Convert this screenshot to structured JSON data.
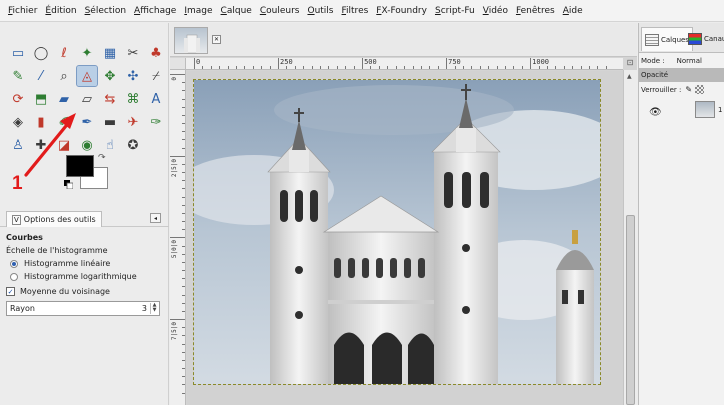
{
  "menubar": {
    "items": [
      "Fichier",
      "Édition",
      "Sélection",
      "Affichage",
      "Image",
      "Calque",
      "Couleurs",
      "Outils",
      "Filtres",
      "FX-Foundry",
      "Script-Fu",
      "Vidéo",
      "Fenêtres",
      "Aide"
    ]
  },
  "toolbox": {
    "annotation_number": "1",
    "tools": [
      {
        "name": "rect-select-tool-icon",
        "glyph": "▭"
      },
      {
        "name": "ellipse-select-tool-icon",
        "glyph": "◯"
      },
      {
        "name": "free-select-tool-icon",
        "glyph": "ℓ"
      },
      {
        "name": "fuzzy-select-tool-icon",
        "glyph": "✦"
      },
      {
        "name": "color-select-tool-icon",
        "glyph": "▦"
      },
      {
        "name": "scissors-select-tool-icon",
        "glyph": "✂"
      },
      {
        "name": "foreground-select-tool-icon",
        "glyph": "♣"
      },
      {
        "name": "paths-tool-icon",
        "glyph": "✎"
      },
      {
        "name": "color-picker-tool-icon",
        "glyph": "⁄"
      },
      {
        "name": "zoom-tool-icon",
        "glyph": "⌕"
      },
      {
        "name": "measure-tool-icon",
        "glyph": "◬"
      },
      {
        "name": "move-tool-icon",
        "glyph": "✥"
      },
      {
        "name": "align-tool-icon",
        "glyph": "✣"
      },
      {
        "name": "crop-tool-icon",
        "glyph": "⌿"
      },
      {
        "name": "rotate-tool-icon",
        "glyph": "⟳"
      },
      {
        "name": "scale-tool-icon",
        "glyph": "⬒"
      },
      {
        "name": "shear-tool-icon",
        "glyph": "▰"
      },
      {
        "name": "perspective-tool-icon",
        "glyph": "▱"
      },
      {
        "name": "flip-tool-icon",
        "glyph": "⇆"
      },
      {
        "name": "cage-tool-icon",
        "glyph": "⌘"
      },
      {
        "name": "text-tool-icon",
        "glyph": "A"
      },
      {
        "name": "bucket-fill-tool-icon",
        "glyph": "◈"
      },
      {
        "name": "blend-tool-icon",
        "glyph": "▮"
      },
      {
        "name": "pencil-tool-icon",
        "glyph": "✐"
      },
      {
        "name": "paintbrush-tool-icon",
        "glyph": "✒"
      },
      {
        "name": "eraser-tool-icon",
        "glyph": "▬"
      },
      {
        "name": "airbrush-tool-icon",
        "glyph": "✈"
      },
      {
        "name": "ink-tool-icon",
        "glyph": "✑"
      },
      {
        "name": "clone-tool-icon",
        "glyph": "♙"
      },
      {
        "name": "heal-tool-icon",
        "glyph": "✚"
      },
      {
        "name": "perspective-clone-tool-icon",
        "glyph": "◪"
      },
      {
        "name": "blur-tool-icon",
        "glyph": "◉"
      },
      {
        "name": "smudge-tool-icon",
        "glyph": "☝"
      },
      {
        "name": "dodge-burn-tool-icon",
        "glyph": "✪"
      }
    ],
    "active_tool_index": 10,
    "fg_color": "#000000",
    "bg_color": "#ffffff"
  },
  "tool_options": {
    "tab_icon": "V",
    "tab_label": "Options des outils",
    "title": "Courbes",
    "histogram_scale_label": "Échelle de l'histogramme",
    "linear_label": "Histogramme linéaire",
    "log_label": "Histogramme logarithmique",
    "linear_selected": true,
    "neighborhood_label": "Moyenne du voisinage",
    "neighborhood_checked": true,
    "radius_label": "Rayon",
    "radius_value": "3"
  },
  "image_window": {
    "ruler_labels": [
      "0",
      "250",
      "500",
      "750",
      "1000"
    ],
    "vruler_labels": [
      "0",
      "2|5|0",
      "5|0|0",
      "7|5|0"
    ]
  },
  "layers_dock": {
    "layers_tab": "Calques",
    "channels_tab": "Canaux",
    "mode_label": "Mode :",
    "mode_value": "Normal",
    "opacity_label": "Opacité",
    "lock_label": "Verrouiller :",
    "layer_name_fragment": "1"
  },
  "colors": {
    "accent_red": "#e21b1b",
    "active_tool_bg": "#b9cfe6"
  }
}
